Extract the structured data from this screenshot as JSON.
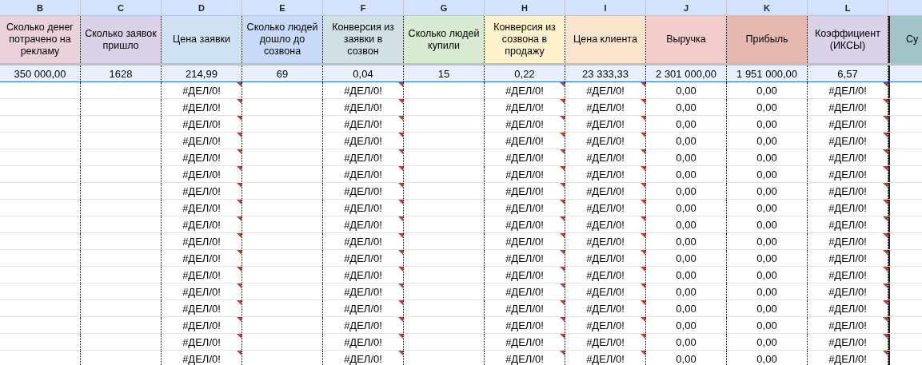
{
  "columns": [
    {
      "letter": "B",
      "title": "Сколько денег потрачено на рекламу",
      "color": "#ead1dc"
    },
    {
      "letter": "C",
      "title": "Сколько заявок пришло",
      "color": "#d9d2e9"
    },
    {
      "letter": "D",
      "title": "Цена заявки",
      "color": "#cfe2f3"
    },
    {
      "letter": "E",
      "title": "Сколько людей дошло до созвона",
      "color": "#c9daf8"
    },
    {
      "letter": "F",
      "title": "Конверсия из заявки в созвон",
      "color": "#d0e0e3"
    },
    {
      "letter": "G",
      "title": "Сколько людей купили",
      "color": "#d9ead3"
    },
    {
      "letter": "H",
      "title": "Конверсия из созвона в продажу",
      "color": "#fff2cc"
    },
    {
      "letter": "I",
      "title": "Цена клиента",
      "color": "#fce5cd"
    },
    {
      "letter": "J",
      "title": "Выручка",
      "color": "#f4cccc"
    },
    {
      "letter": "K",
      "title": "Прибыль",
      "color": "#e6b8af"
    },
    {
      "letter": "L",
      "title": "Коэффициент (ИКСЫ)",
      "color": "#d9d2e9"
    },
    {
      "title": "Су",
      "color": "#a2c4c9"
    }
  ],
  "rows": [
    {
      "selected": true,
      "cells": [
        {
          "kind": "value",
          "text": "350 000,00"
        },
        {
          "kind": "value",
          "text": "1628"
        },
        {
          "kind": "value",
          "text": "214,99"
        },
        {
          "kind": "value",
          "text": "69"
        },
        {
          "kind": "value",
          "text": "0,04"
        },
        {
          "kind": "value",
          "text": "15"
        },
        {
          "kind": "value",
          "text": "0,22"
        },
        {
          "kind": "value",
          "text": "23 333,33"
        },
        {
          "kind": "value",
          "text": "2 301 000,00"
        },
        {
          "kind": "value",
          "text": "1 951 000,00"
        },
        {
          "kind": "value",
          "text": "6,57"
        },
        {
          "kind": "empty"
        }
      ]
    },
    {
      "selected": false,
      "cells": [
        {
          "kind": "empty"
        },
        {
          "kind": "empty"
        },
        {
          "kind": "error",
          "text": "#ДЕЛ/0!"
        },
        {
          "kind": "empty"
        },
        {
          "kind": "error",
          "text": "#ДЕЛ/0!"
        },
        {
          "kind": "empty"
        },
        {
          "kind": "error",
          "text": "#ДЕЛ/0!"
        },
        {
          "kind": "error",
          "text": "#ДЕЛ/0!"
        },
        {
          "kind": "value",
          "text": "0,00"
        },
        {
          "kind": "value",
          "text": "0,00"
        },
        {
          "kind": "error",
          "text": "#ДЕЛ/0!"
        },
        {
          "kind": "empty"
        }
      ]
    },
    {
      "selected": false,
      "cells": [
        {
          "kind": "empty"
        },
        {
          "kind": "empty"
        },
        {
          "kind": "error",
          "text": "#ДЕЛ/0!"
        },
        {
          "kind": "empty"
        },
        {
          "kind": "error",
          "text": "#ДЕЛ/0!"
        },
        {
          "kind": "empty"
        },
        {
          "kind": "error",
          "text": "#ДЕЛ/0!"
        },
        {
          "kind": "error",
          "text": "#ДЕЛ/0!"
        },
        {
          "kind": "value",
          "text": "0,00"
        },
        {
          "kind": "value",
          "text": "0,00"
        },
        {
          "kind": "error",
          "text": "#ДЕЛ/0!"
        },
        {
          "kind": "empty"
        }
      ]
    },
    {
      "selected": false,
      "cells": [
        {
          "kind": "empty"
        },
        {
          "kind": "empty"
        },
        {
          "kind": "error",
          "text": "#ДЕЛ/0!"
        },
        {
          "kind": "empty"
        },
        {
          "kind": "error",
          "text": "#ДЕЛ/0!"
        },
        {
          "kind": "empty"
        },
        {
          "kind": "error",
          "text": "#ДЕЛ/0!"
        },
        {
          "kind": "error",
          "text": "#ДЕЛ/0!"
        },
        {
          "kind": "value",
          "text": "0,00"
        },
        {
          "kind": "value",
          "text": "0,00"
        },
        {
          "kind": "error",
          "text": "#ДЕЛ/0!"
        },
        {
          "kind": "empty"
        }
      ]
    },
    {
      "selected": false,
      "cells": [
        {
          "kind": "empty"
        },
        {
          "kind": "empty"
        },
        {
          "kind": "error",
          "text": "#ДЕЛ/0!"
        },
        {
          "kind": "empty"
        },
        {
          "kind": "error",
          "text": "#ДЕЛ/0!"
        },
        {
          "kind": "empty"
        },
        {
          "kind": "error",
          "text": "#ДЕЛ/0!"
        },
        {
          "kind": "error",
          "text": "#ДЕЛ/0!"
        },
        {
          "kind": "value",
          "text": "0,00"
        },
        {
          "kind": "value",
          "text": "0,00"
        },
        {
          "kind": "error",
          "text": "#ДЕЛ/0!"
        },
        {
          "kind": "empty"
        }
      ]
    },
    {
      "selected": false,
      "cells": [
        {
          "kind": "empty"
        },
        {
          "kind": "empty"
        },
        {
          "kind": "error",
          "text": "#ДЕЛ/0!"
        },
        {
          "kind": "empty"
        },
        {
          "kind": "error",
          "text": "#ДЕЛ/0!"
        },
        {
          "kind": "empty"
        },
        {
          "kind": "error",
          "text": "#ДЕЛ/0!"
        },
        {
          "kind": "error",
          "text": "#ДЕЛ/0!"
        },
        {
          "kind": "value",
          "text": "0,00"
        },
        {
          "kind": "value",
          "text": "0,00"
        },
        {
          "kind": "error",
          "text": "#ДЕЛ/0!"
        },
        {
          "kind": "empty"
        }
      ]
    },
    {
      "selected": false,
      "cells": [
        {
          "kind": "empty"
        },
        {
          "kind": "empty"
        },
        {
          "kind": "error",
          "text": "#ДЕЛ/0!"
        },
        {
          "kind": "empty"
        },
        {
          "kind": "error",
          "text": "#ДЕЛ/0!"
        },
        {
          "kind": "empty"
        },
        {
          "kind": "error",
          "text": "#ДЕЛ/0!"
        },
        {
          "kind": "error",
          "text": "#ДЕЛ/0!"
        },
        {
          "kind": "value",
          "text": "0,00"
        },
        {
          "kind": "value",
          "text": "0,00"
        },
        {
          "kind": "error",
          "text": "#ДЕЛ/0!"
        },
        {
          "kind": "empty"
        }
      ]
    },
    {
      "selected": false,
      "cells": [
        {
          "kind": "empty"
        },
        {
          "kind": "empty"
        },
        {
          "kind": "error",
          "text": "#ДЕЛ/0!"
        },
        {
          "kind": "empty"
        },
        {
          "kind": "error",
          "text": "#ДЕЛ/0!"
        },
        {
          "kind": "empty"
        },
        {
          "kind": "error",
          "text": "#ДЕЛ/0!"
        },
        {
          "kind": "error",
          "text": "#ДЕЛ/0!"
        },
        {
          "kind": "value",
          "text": "0,00"
        },
        {
          "kind": "value",
          "text": "0,00"
        },
        {
          "kind": "error",
          "text": "#ДЕЛ/0!"
        },
        {
          "kind": "empty"
        }
      ]
    },
    {
      "selected": false,
      "cells": [
        {
          "kind": "empty"
        },
        {
          "kind": "empty"
        },
        {
          "kind": "error",
          "text": "#ДЕЛ/0!"
        },
        {
          "kind": "empty"
        },
        {
          "kind": "error",
          "text": "#ДЕЛ/0!"
        },
        {
          "kind": "empty"
        },
        {
          "kind": "error",
          "text": "#ДЕЛ/0!"
        },
        {
          "kind": "error",
          "text": "#ДЕЛ/0!"
        },
        {
          "kind": "value",
          "text": "0,00"
        },
        {
          "kind": "value",
          "text": "0,00"
        },
        {
          "kind": "error",
          "text": "#ДЕЛ/0!"
        },
        {
          "kind": "empty"
        }
      ]
    },
    {
      "selected": false,
      "cells": [
        {
          "kind": "empty"
        },
        {
          "kind": "empty"
        },
        {
          "kind": "error",
          "text": "#ДЕЛ/0!"
        },
        {
          "kind": "empty"
        },
        {
          "kind": "error",
          "text": "#ДЕЛ/0!"
        },
        {
          "kind": "empty"
        },
        {
          "kind": "error",
          "text": "#ДЕЛ/0!"
        },
        {
          "kind": "error",
          "text": "#ДЕЛ/0!"
        },
        {
          "kind": "value",
          "text": "0,00"
        },
        {
          "kind": "value",
          "text": "0,00"
        },
        {
          "kind": "error",
          "text": "#ДЕЛ/0!"
        },
        {
          "kind": "empty"
        }
      ]
    },
    {
      "selected": false,
      "cells": [
        {
          "kind": "empty"
        },
        {
          "kind": "empty"
        },
        {
          "kind": "error",
          "text": "#ДЕЛ/0!"
        },
        {
          "kind": "empty"
        },
        {
          "kind": "error",
          "text": "#ДЕЛ/0!"
        },
        {
          "kind": "empty"
        },
        {
          "kind": "error",
          "text": "#ДЕЛ/0!"
        },
        {
          "kind": "error",
          "text": "#ДЕЛ/0!"
        },
        {
          "kind": "value",
          "text": "0,00"
        },
        {
          "kind": "value",
          "text": "0,00"
        },
        {
          "kind": "error",
          "text": "#ДЕЛ/0!"
        },
        {
          "kind": "empty"
        }
      ]
    },
    {
      "selected": false,
      "cells": [
        {
          "kind": "empty"
        },
        {
          "kind": "empty"
        },
        {
          "kind": "error",
          "text": "#ДЕЛ/0!"
        },
        {
          "kind": "empty"
        },
        {
          "kind": "error",
          "text": "#ДЕЛ/0!"
        },
        {
          "kind": "empty"
        },
        {
          "kind": "error",
          "text": "#ДЕЛ/0!"
        },
        {
          "kind": "error",
          "text": "#ДЕЛ/0!"
        },
        {
          "kind": "value",
          "text": "0,00"
        },
        {
          "kind": "value",
          "text": "0,00"
        },
        {
          "kind": "error",
          "text": "#ДЕЛ/0!"
        },
        {
          "kind": "empty"
        }
      ]
    },
    {
      "selected": false,
      "cells": [
        {
          "kind": "empty"
        },
        {
          "kind": "empty"
        },
        {
          "kind": "error",
          "text": "#ДЕЛ/0!"
        },
        {
          "kind": "empty"
        },
        {
          "kind": "error",
          "text": "#ДЕЛ/0!"
        },
        {
          "kind": "empty"
        },
        {
          "kind": "error",
          "text": "#ДЕЛ/0!"
        },
        {
          "kind": "error",
          "text": "#ДЕЛ/0!"
        },
        {
          "kind": "value",
          "text": "0,00"
        },
        {
          "kind": "value",
          "text": "0,00"
        },
        {
          "kind": "error",
          "text": "#ДЕЛ/0!"
        },
        {
          "kind": "empty"
        }
      ]
    },
    {
      "selected": false,
      "cells": [
        {
          "kind": "empty"
        },
        {
          "kind": "empty"
        },
        {
          "kind": "error",
          "text": "#ДЕЛ/0!"
        },
        {
          "kind": "empty"
        },
        {
          "kind": "error",
          "text": "#ДЕЛ/0!"
        },
        {
          "kind": "empty"
        },
        {
          "kind": "error",
          "text": "#ДЕЛ/0!"
        },
        {
          "kind": "error",
          "text": "#ДЕЛ/0!"
        },
        {
          "kind": "value",
          "text": "0,00"
        },
        {
          "kind": "value",
          "text": "0,00"
        },
        {
          "kind": "error",
          "text": "#ДЕЛ/0!"
        },
        {
          "kind": "empty"
        }
      ]
    },
    {
      "selected": false,
      "cells": [
        {
          "kind": "empty"
        },
        {
          "kind": "empty"
        },
        {
          "kind": "error",
          "text": "#ДЕЛ/0!"
        },
        {
          "kind": "empty"
        },
        {
          "kind": "error",
          "text": "#ДЕЛ/0!"
        },
        {
          "kind": "empty"
        },
        {
          "kind": "error",
          "text": "#ДЕЛ/0!"
        },
        {
          "kind": "error",
          "text": "#ДЕЛ/0!"
        },
        {
          "kind": "value",
          "text": "0,00"
        },
        {
          "kind": "value",
          "text": "0,00"
        },
        {
          "kind": "error",
          "text": "#ДЕЛ/0!"
        },
        {
          "kind": "empty"
        }
      ]
    },
    {
      "selected": false,
      "cells": [
        {
          "kind": "empty"
        },
        {
          "kind": "empty"
        },
        {
          "kind": "error",
          "text": "#ДЕЛ/0!"
        },
        {
          "kind": "empty"
        },
        {
          "kind": "error",
          "text": "#ДЕЛ/0!"
        },
        {
          "kind": "empty"
        },
        {
          "kind": "error",
          "text": "#ДЕЛ/0!"
        },
        {
          "kind": "error",
          "text": "#ДЕЛ/0!"
        },
        {
          "kind": "value",
          "text": "0,00"
        },
        {
          "kind": "value",
          "text": "0,00"
        },
        {
          "kind": "error",
          "text": "#ДЕЛ/0!"
        },
        {
          "kind": "empty"
        }
      ]
    },
    {
      "selected": false,
      "cells": [
        {
          "kind": "empty"
        },
        {
          "kind": "empty"
        },
        {
          "kind": "error",
          "text": "#ДЕЛ/0!"
        },
        {
          "kind": "empty"
        },
        {
          "kind": "error",
          "text": "#ДЕЛ/0!"
        },
        {
          "kind": "empty"
        },
        {
          "kind": "error",
          "text": "#ДЕЛ/0!"
        },
        {
          "kind": "error",
          "text": "#ДЕЛ/0!"
        },
        {
          "kind": "value",
          "text": "0,00"
        },
        {
          "kind": "value",
          "text": "0,00"
        },
        {
          "kind": "error",
          "text": "#ДЕЛ/0!"
        },
        {
          "kind": "empty"
        }
      ]
    },
    {
      "selected": false,
      "cells": [
        {
          "kind": "empty"
        },
        {
          "kind": "empty"
        },
        {
          "kind": "error",
          "text": "#ДЕЛ/0!"
        },
        {
          "kind": "empty"
        },
        {
          "kind": "error",
          "text": "#ДЕЛ/0!"
        },
        {
          "kind": "empty"
        },
        {
          "kind": "error",
          "text": "#ДЕЛ/0!"
        },
        {
          "kind": "error",
          "text": "#ДЕЛ/0!"
        },
        {
          "kind": "value",
          "text": "0,00"
        },
        {
          "kind": "value",
          "text": "0,00"
        },
        {
          "kind": "error",
          "text": "#ДЕЛ/0!"
        },
        {
          "kind": "empty"
        }
      ]
    }
  ]
}
